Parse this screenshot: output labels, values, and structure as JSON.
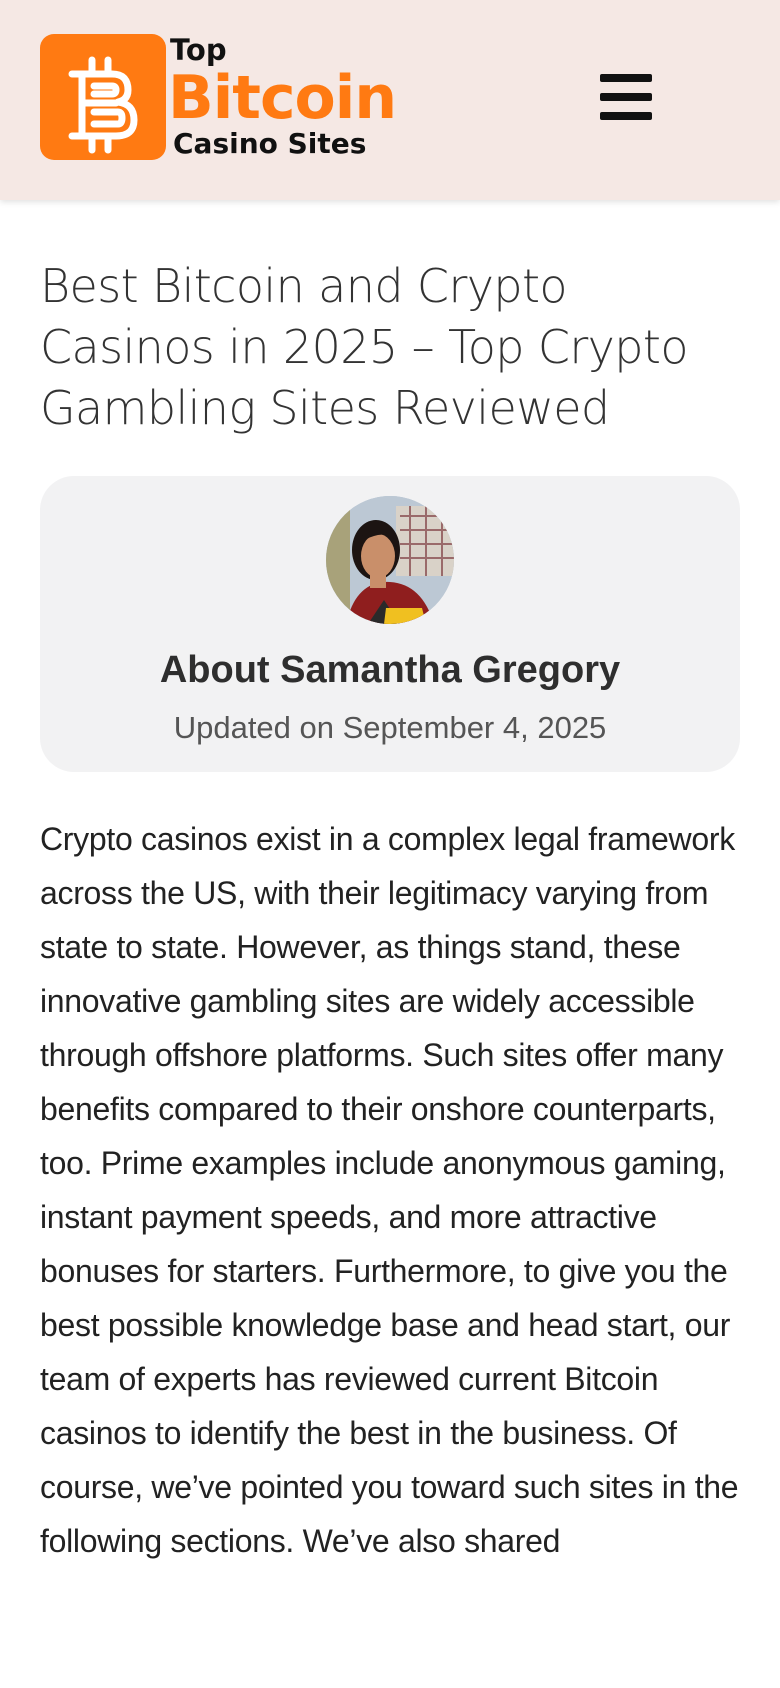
{
  "header": {
    "logo": {
      "top_text": "Top",
      "main_text": "Bitcoin",
      "bottom_text": "Casino Sites",
      "brand_color": "#ff7a12",
      "icon": "bitcoin-icon"
    },
    "menu_icon": "hamburger-menu-icon",
    "background": "#f5e8e4"
  },
  "article": {
    "title": "Best Bitcoin and Crypto Casinos in 2025 – Top Crypto Gambling Sites Reviewed",
    "author_card": {
      "name": "About Samantha Gregory",
      "updated": "Updated on September 4, 2025",
      "avatar_icon": "author-avatar"
    },
    "intro": "Crypto casinos exist in a complex legal framework across the US, with their legitimacy varying from state to state. However, as things stand, these innovative gambling sites are widely accessible through offshore platforms. Such sites offer many benefits compared to their onshore counterparts, too. Prime examples include anonymous gaming, instant payment speeds, and more attractive bonuses for starters. Furthermore, to give you the best possible knowledge base and head start, our team of experts has reviewed current Bitcoin casinos to identify the best in the business. Of course, we’ve pointed you toward such sites in the following sections. We’ve also shared"
  }
}
